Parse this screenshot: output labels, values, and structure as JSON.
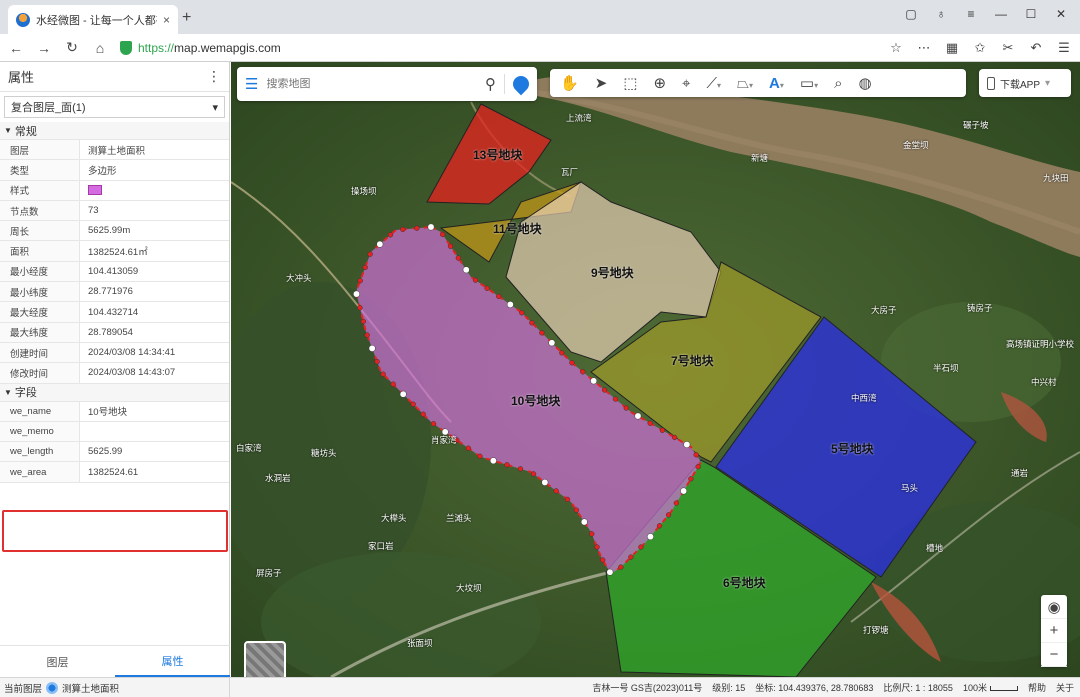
{
  "browser": {
    "tab_title": "水经微图 - 让每一个人都有自",
    "url_protocol": "https://",
    "url_rest": "map.wemapgis.com",
    "close_glyph": "×",
    "newtab_glyph": "+"
  },
  "panel": {
    "title": "属性",
    "layer_select": "复合图层_面(1)",
    "section_general": "常规",
    "general_rows": [
      {
        "k": "图层",
        "v": "测算土地面积"
      },
      {
        "k": "类型",
        "v": "多边形"
      },
      {
        "k": "样式",
        "v": ""
      },
      {
        "k": "节点数",
        "v": "73"
      },
      {
        "k": "周长",
        "v": "5625.99m"
      },
      {
        "k": "面积",
        "v": "1382524.61㎡"
      },
      {
        "k": "最小经度",
        "v": "104.413059"
      },
      {
        "k": "最小纬度",
        "v": "28.771976"
      },
      {
        "k": "最大经度",
        "v": "104.432714"
      },
      {
        "k": "最大纬度",
        "v": "28.789054"
      },
      {
        "k": "创建时间",
        "v": "2024/03/08 14:34:41"
      },
      {
        "k": "修改时间",
        "v": "2024/03/08 14:43:07"
      }
    ],
    "section_fields": "字段",
    "field_rows": [
      {
        "k": "we_name",
        "v": "10号地块"
      },
      {
        "k": "we_memo",
        "v": ""
      },
      {
        "k": "we_length",
        "v": "5625.99"
      },
      {
        "k": "we_area",
        "v": "1382524.61"
      }
    ],
    "tabs": [
      "图层",
      "属性"
    ],
    "style_color": "#d46be0"
  },
  "search": {
    "placeholder": "搜索地图"
  },
  "download_label": "下载APP",
  "status": {
    "current_layer_label": "当前图层",
    "current_layer": "测算土地面积",
    "source": "吉林一号 GS吉(2023)011号",
    "level": "级别: 15",
    "coords": "坐标: 104.439376, 28.780683",
    "ratio": "比例尺: 1 : 18055",
    "scale": "100米",
    "help": "帮助",
    "about": "关于"
  },
  "plots": [
    {
      "name": "13号地块",
      "color": "#e8231f"
    },
    {
      "name": "11号地块",
      "color": "#c89a18"
    },
    {
      "name": "9号地块",
      "color": "#f2d7bf"
    },
    {
      "name": "10号地块",
      "color": "#cf6fd8"
    },
    {
      "name": "7号地块",
      "color": "#a8a02a"
    },
    {
      "name": "5号地块",
      "color": "#2a2ee8"
    },
    {
      "name": "6号地块",
      "color": "#2fa82a"
    }
  ],
  "places": [
    "操场坝",
    "大冲头",
    "瓦厂",
    "白家湾",
    "肖家湾",
    "糖坊头",
    "水洞岩",
    "大榉头",
    "兰滩头",
    "家口岩",
    "大坟坝",
    "张面坝",
    "打锣塘",
    "碾子坡",
    "金堂坝",
    "九块田",
    "大房子",
    "中西湾",
    "半石坝",
    "铸房子",
    "高场镇证明小学校",
    "中兴村",
    "通岩",
    "槽地",
    "屏房子",
    "马头",
    "上流湾",
    "新塘"
  ]
}
